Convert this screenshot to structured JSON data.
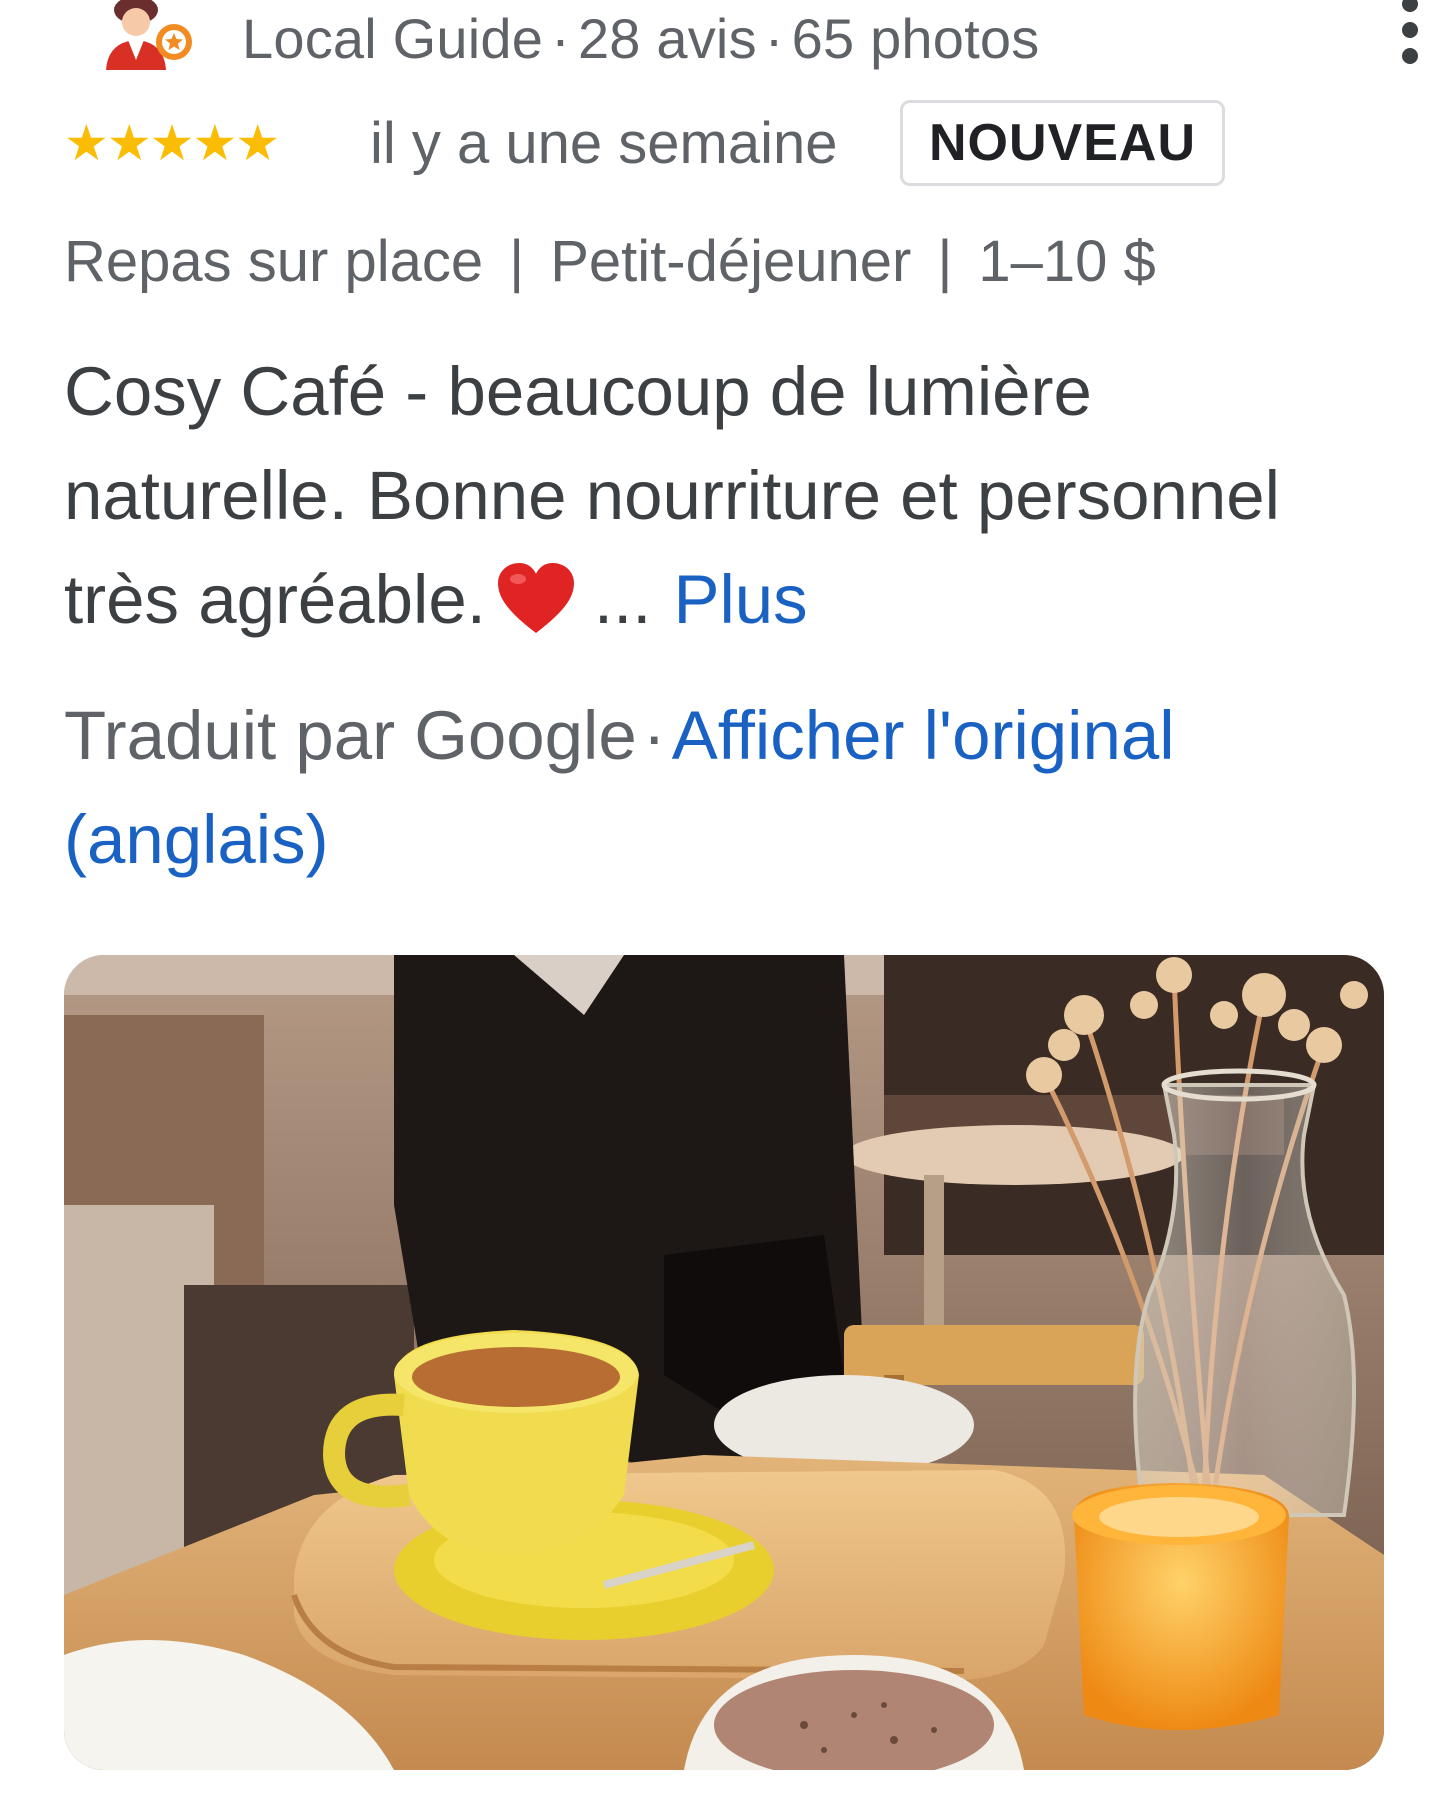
{
  "author": {
    "badge": "Local Guide",
    "reviews": "28 avis",
    "photos": "65 photos",
    "separator": "·"
  },
  "rating": {
    "stars": 5,
    "max": 5,
    "stars_text": "★★★★★",
    "date": "il y a une semaine",
    "badge_label": "NOUVEAU"
  },
  "tags": [
    "Repas sur place",
    "Petit-déjeuner",
    "1–10 $"
  ],
  "tag_separator": "|",
  "review": {
    "text": "Cosy Café - beaucoup de lumière naturelle. Bonne nourriture et personnel très agréable.",
    "ellipsis": "...",
    "more_link": "Plus"
  },
  "translation": {
    "label": "Traduit par Google",
    "separator": "·",
    "link": "Afficher l'original (anglais)"
  },
  "colors": {
    "star": "#fbbc04",
    "link": "#1a61c4",
    "muted_text": "#5f6368",
    "badge_border": "#dadce0",
    "heart": "#e02424"
  },
  "icons": {
    "avatar": "local-guide-avatar",
    "menu": "more-vertical-icon",
    "heart": "red-heart-emoji"
  }
}
